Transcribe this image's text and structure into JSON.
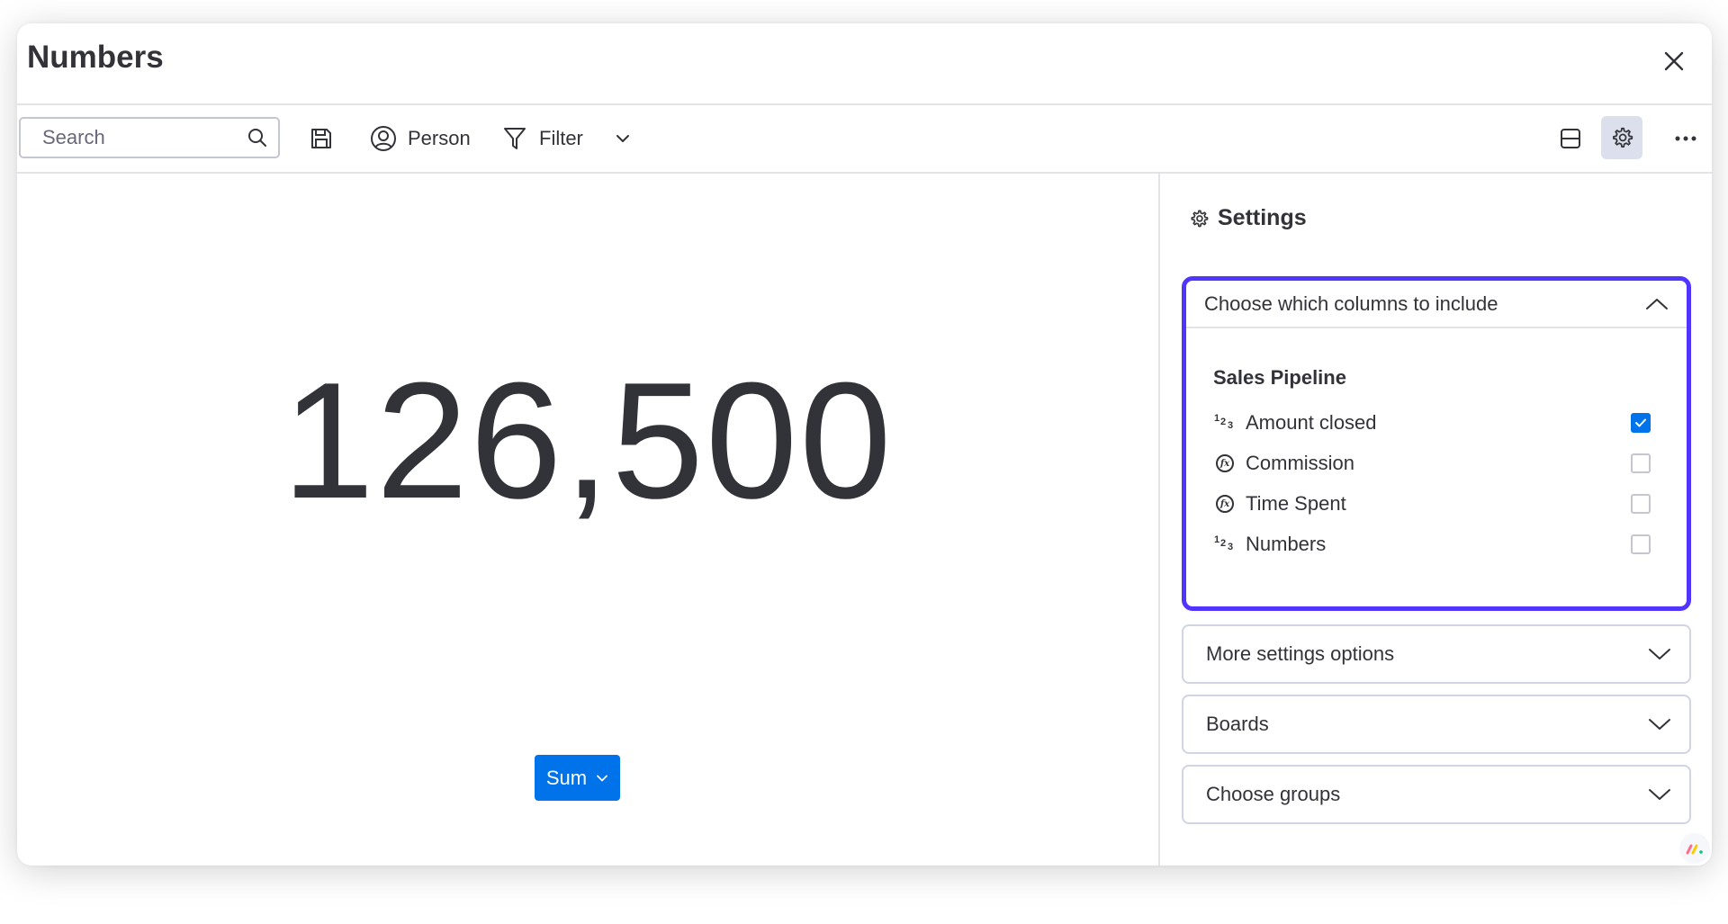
{
  "window": {
    "title": "Numbers"
  },
  "toolbar": {
    "search_placeholder": "Search",
    "person_label": "Person",
    "filter_label": "Filter"
  },
  "widget": {
    "value": "126,500",
    "function_label": "Sum"
  },
  "settings": {
    "title": "Settings",
    "columns_section": {
      "title": "Choose which columns to include",
      "group_name": "Sales Pipeline",
      "columns": [
        {
          "label": "Amount closed",
          "icon": "numbers-column-icon",
          "checked": true
        },
        {
          "label": "Commission",
          "icon": "formula-column-icon",
          "checked": false
        },
        {
          "label": "Time Spent",
          "icon": "formula-column-icon",
          "checked": false
        },
        {
          "label": "Numbers",
          "icon": "numbers-column-icon",
          "checked": false
        }
      ]
    },
    "more_settings_label": "More settings options",
    "boards_label": "Boards",
    "groups_label": "Choose groups"
  },
  "colors": {
    "accent": "#0073ea",
    "active_border": "#5034ff",
    "text": "#323338"
  }
}
